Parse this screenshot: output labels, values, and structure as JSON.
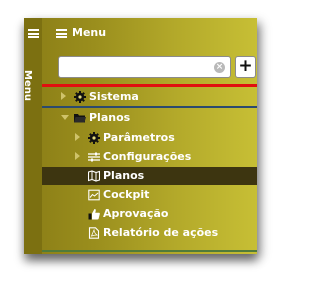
{
  "sidebar": {
    "label": "Menu"
  },
  "header": {
    "title": "Menu"
  },
  "search": {
    "value": "",
    "placeholder": ""
  },
  "tree": {
    "sistema": "Sistema",
    "planos": "Planos",
    "parametros": "Parâmetros",
    "configuracoes": "Configurações",
    "planos_item": "Planos",
    "cockpit": "Cockpit",
    "aprovacao": "Aprovação",
    "relatorio": "Relatório de ações"
  },
  "icons": {
    "strip_menu": "hamburger-icon",
    "header_menu": "hamburger-icon",
    "clear": "clear-icon",
    "add": "plus-icon",
    "sistema": "gear-icon",
    "planos": "folder-open-icon",
    "parametros": "gear-icon",
    "configuracoes": "sliders-icon",
    "planos_item": "map-icon",
    "cockpit": "monitor-icon",
    "aprovacao": "thumbs-up-icon",
    "relatorio": "document-icon"
  },
  "colors": {
    "panel": "#9a8e1d",
    "strip": "#7c7011",
    "selected": "#3d3510",
    "accent_red": "#e10f0f",
    "accent_blue": "#2b4a6f",
    "accent_green": "#4f7a3a"
  }
}
